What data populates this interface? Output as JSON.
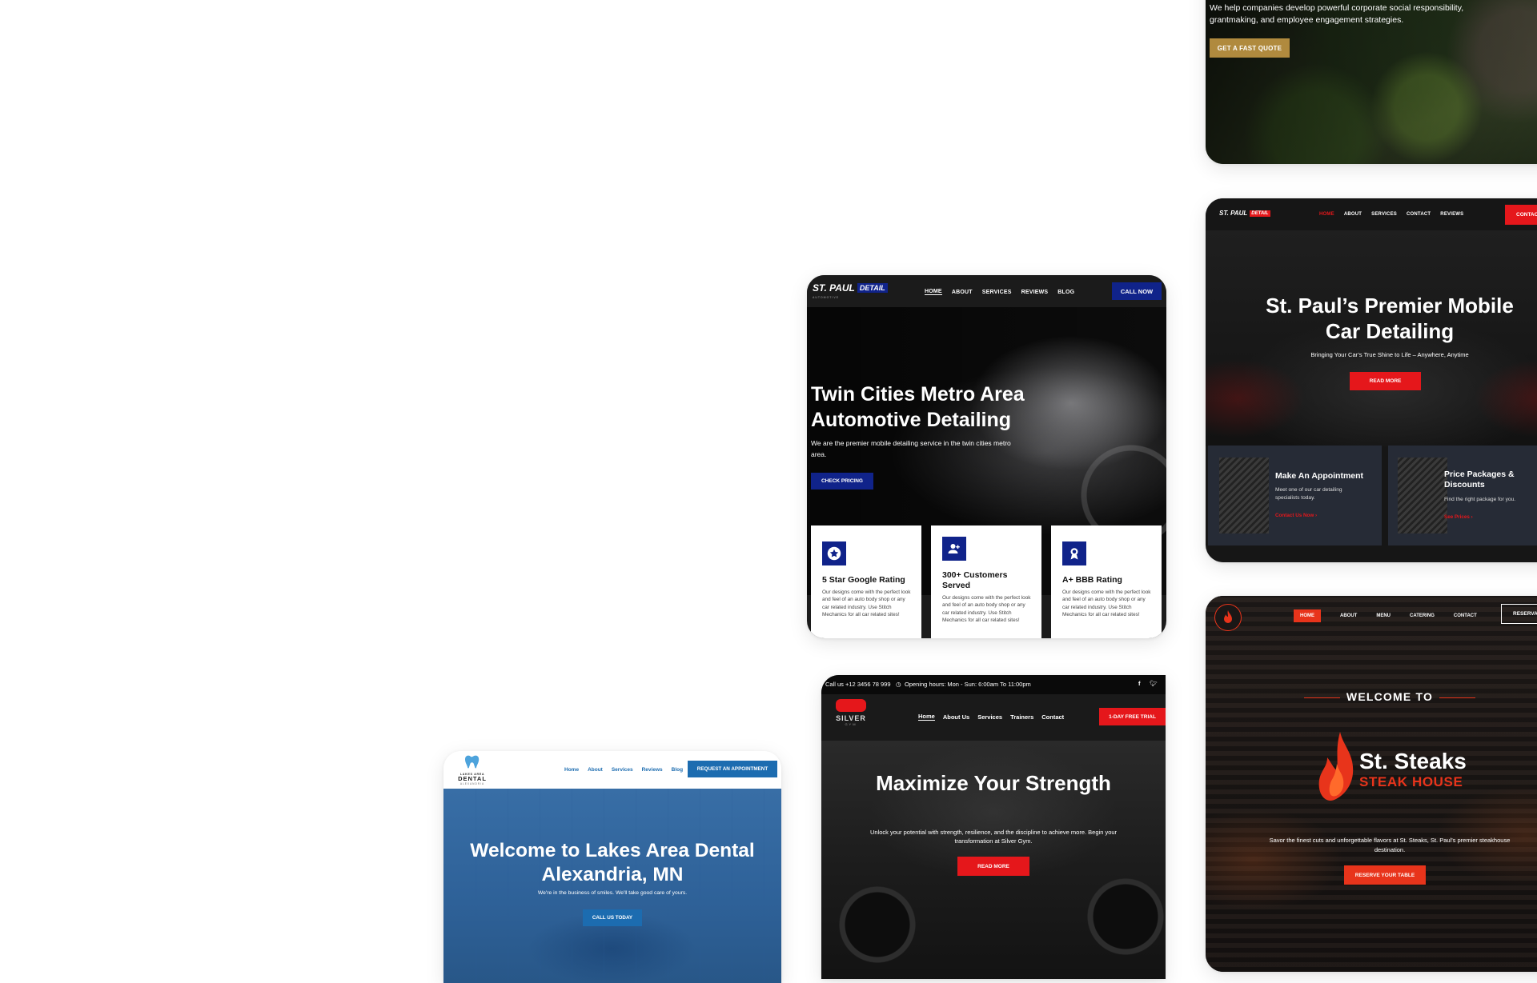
{
  "csr": {
    "description": "We help companies develop powerful corporate social responsibility, grantmaking, and employee engagement strategies.",
    "cta": "GET A FAST QUOTE"
  },
  "detail": {
    "logo_main": "ST. PAUL",
    "logo_badge": "DETAIL",
    "logo_sub": "AUTOMOTIVE",
    "nav": [
      "HOME",
      "ABOUT",
      "SERVICES",
      "REVIEWS",
      "BLOG"
    ],
    "call_btn": "CALL NOW",
    "heading": "Twin Cities Metro Area Automotive Detailing",
    "subheading": "We are the premier mobile detailing service in the twin cities metro area.",
    "cta": "CHECK PRICING",
    "features": [
      {
        "title": "5 Star Google Rating",
        "text": "Our designs come with the perfect look and feel of an auto body shop or any car related industry. Use Stitch Mechanics for all car related sites!",
        "icon": "star-icon"
      },
      {
        "title": "300+ Customers Served",
        "text": "Our designs come with the perfect look and feel of an auto body shop or any car related industry. Use Stitch Mechanics for all car related sites!",
        "icon": "user-add-icon"
      },
      {
        "title": "A+ BBB Rating",
        "text": "Our designs come with the perfect look and feel of an auto body shop or any car related industry. Use Stitch Mechanics for all car related sites!",
        "icon": "award-icon"
      }
    ],
    "colors": {
      "brand": "#10238a"
    }
  },
  "premier": {
    "logo_main": "ST. PAUL",
    "logo_badge": "DETAIL",
    "nav": [
      "HOME",
      "ABOUT",
      "SERVICES",
      "CONTACT",
      "REVIEWS"
    ],
    "contact_btn": "CONTAC",
    "heading": "St. Paul’s Premier Mobile Car Detailing",
    "subheading": "Bringing Your Car’s True Shine to Life – Anywhere, Anytime",
    "cta": "READ MORE",
    "panels": [
      {
        "title": "Make An Appointment",
        "text": "Meet one of our car detailing specialists today.",
        "link": "Contact Us Now"
      },
      {
        "title": "Price Packages & Discounts",
        "text": "Find the right package for you.",
        "link": "See Prices"
      }
    ],
    "colors": {
      "accent": "#e5171b"
    }
  },
  "gym": {
    "phone": "Call us +12 3456 78 999",
    "hours": "Opening hours: Mon - Sun: 6:00am To 11:00pm",
    "logo": "SILVER",
    "logo_sub": "GYM",
    "nav": [
      "Home",
      "About Us",
      "Services",
      "Trainers",
      "Contact"
    ],
    "trial_btn": "1-DAY FREE TRIAL",
    "heading": "Maximize Your Strength",
    "subheading": "Unlock your potential with strength, resilience, and the discipline to achieve more. Begin your transformation at Silver Gym.",
    "cta": "READ MORE",
    "colors": {
      "accent": "#e5171b"
    }
  },
  "dental": {
    "logo_top": "LAKES AREA",
    "logo_main": "DENTAL",
    "logo_sub": "ALEXANDRIA",
    "nav": [
      "Home",
      "About",
      "Services",
      "Reviews",
      "Blog"
    ],
    "appointment_btn": "REQUEST AN APPOINTMENT",
    "heading": "Welcome to Lakes Area Dental Alexandria, MN",
    "subheading": "We're in the business of smiles. We'll take good care of yours.",
    "cta": "CALL US TODAY",
    "colors": {
      "brand": "#1c6cb0"
    }
  },
  "steaks": {
    "nav": [
      "HOME",
      "ABOUT",
      "MENU",
      "CATERING",
      "CONTACT"
    ],
    "reserve_btn": "RESERVA",
    "welcome": "WELCOME TO",
    "brand_main": "St. Steaks",
    "brand_sub": "STEAK HOUSE",
    "subheading": "Savor the finest cuts and unforgettable flavors at St. Steaks, St. Paul's premier steakhouse destination.",
    "cta": "RESERVE YOUR TABLE",
    "colors": {
      "accent": "#e8341b"
    }
  }
}
